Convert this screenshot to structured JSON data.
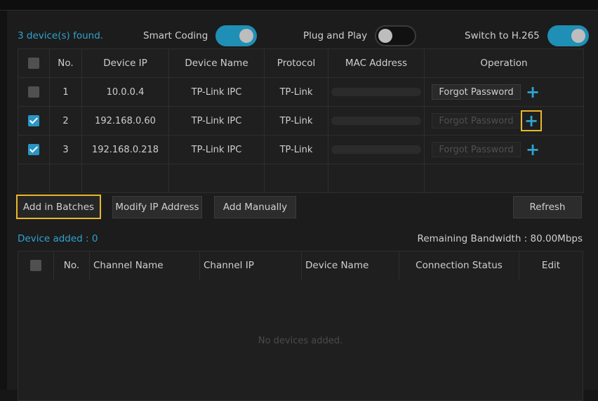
{
  "header": {
    "found_text": "3 device(s) found.",
    "toggles": [
      {
        "label": "Smart Coding",
        "state": "on"
      },
      {
        "label": "Plug and Play",
        "state": "off"
      },
      {
        "label": "Switch to H.265",
        "state": "on"
      }
    ]
  },
  "device_table": {
    "columns": [
      "No.",
      "Device IP",
      "Device Name",
      "Protocol",
      "MAC Address",
      "Operation"
    ],
    "rows": [
      {
        "checked": false,
        "no": "1",
        "ip": "10.0.0.4",
        "name": "TP-Link IPC",
        "protocol": "TP-Link",
        "forgot_password": "Forgot Password",
        "fp_enabled": true
      },
      {
        "checked": true,
        "no": "2",
        "ip": "192.168.0.60",
        "name": "TP-Link IPC",
        "protocol": "TP-Link",
        "forgot_password": "Forgot Password",
        "fp_enabled": false
      },
      {
        "checked": true,
        "no": "3",
        "ip": "192.168.0.218",
        "name": "TP-Link IPC",
        "protocol": "TP-Link",
        "forgot_password": "Forgot Password",
        "fp_enabled": false
      }
    ]
  },
  "actions": {
    "add_in_batches": "Add in Batches",
    "modify_ip": "Modify IP Address",
    "add_manually": "Add Manually",
    "refresh": "Refresh"
  },
  "added_section": {
    "device_added": "Device added : 0",
    "remaining_bandwidth": "Remaining Bandwidth : 80.00Mbps"
  },
  "channel_table": {
    "columns": [
      "No.",
      "Channel Name",
      "Channel IP",
      "Device Name",
      "Connection Status",
      "Edit"
    ],
    "empty_text": "No devices added."
  },
  "colors": {
    "accent": "#2fa3cf",
    "highlight": "#e9b72a",
    "background": "#1c1c1c"
  }
}
